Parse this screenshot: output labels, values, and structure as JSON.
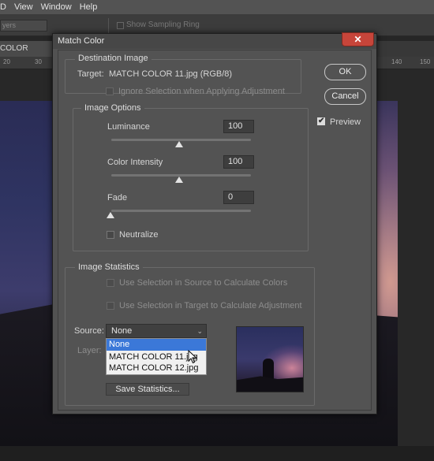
{
  "menubar": {
    "items": [
      "D",
      "View",
      "Window",
      "Help"
    ]
  },
  "optionsbar": {
    "layers_label": "yers",
    "sampling_ring_label": "Show Sampling Ring"
  },
  "document_tab": {
    "label": "COLOR 12.jpg",
    "close": "×"
  },
  "ruler": {
    "ticks": [
      "20",
      "30",
      "140",
      "150"
    ]
  },
  "dialog": {
    "title": "Match Color",
    "close": "✕",
    "ok_label": "OK",
    "cancel_label": "Cancel",
    "preview_label": "Preview",
    "preview_checked": true,
    "destination": {
      "legend": "Destination Image",
      "target_label": "Target:",
      "target_value": "MATCH COLOR 11.jpg (RGB/8)",
      "ignore_selection_label": "Ignore Selection when Applying Adjustment"
    },
    "options": {
      "legend": "Image Options",
      "luminance_label": "Luminance",
      "luminance_value": "100",
      "intensity_label": "Color Intensity",
      "intensity_value": "100",
      "fade_label": "Fade",
      "fade_value": "0",
      "neutralize_label": "Neutralize"
    },
    "statistics": {
      "legend": "Image Statistics",
      "use_source_label": "Use Selection in Source to Calculate Colors",
      "use_target_label": "Use Selection in Target to Calculate Adjustment",
      "source_label": "Source:",
      "source_value": "None",
      "layer_label": "Layer:",
      "dropdown_options": [
        "None",
        "MATCH COLOR 11.jpg",
        "MATCH COLOR 12.jpg"
      ],
      "save_label": "Save Statistics..."
    }
  }
}
